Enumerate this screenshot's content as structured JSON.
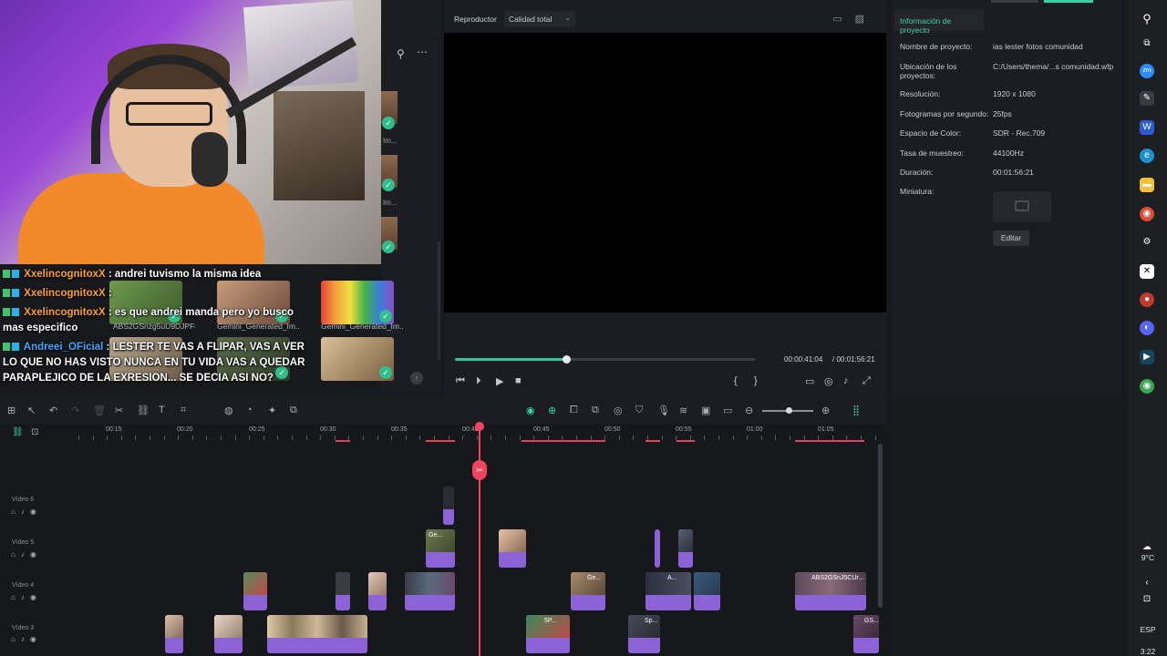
{
  "chat": [
    {
      "user": "XxelincognitoxX",
      "msg": " : andrei tuvismo la misma idea",
      "color": "orange"
    },
    {
      "user": "XxelincognitoxX",
      "msg": " :",
      "color": "orange"
    },
    {
      "user": "XxelincognitoxX",
      "msg": " : es que andrei manda pero yo busco mas especifico",
      "color": "orange"
    },
    {
      "user": "Andreei_OFicial",
      "msg": " : LESTER TE VAS A FLIPAR, VAS A VER LO QUE NO HAS VISTO NUNCA EN TU VIDA VAS A QUEDAR PARAPLEJICO DE LA EXRESION... SE DECIA ASI NO?",
      "color": "blue"
    }
  ],
  "media": {
    "thumb_labels": [
      "ABS2GSnzg5uU9DJPF8...",
      "Gemini_Generated_Im...",
      "Gemini_Generated_Im...",
      "Gemini_Generated_Im..."
    ],
    "side_labels": [
      "Im...",
      "Im...",
      "Im...",
      "Generated_Im..."
    ]
  },
  "player": {
    "title": "Reproductor",
    "quality": "Calidad total",
    "time_current": "00:00:41:04",
    "time_total": "/ 00:01:56:21",
    "progress": 0.37
  },
  "project_info": {
    "tab": "Información de proyecto",
    "rows": [
      {
        "label": "Nombre de proyecto:",
        "value": "ias lester fotos comunidad"
      },
      {
        "label": "Ubicación de los proyectos:",
        "value": "C:/Users/thema/...s comunidad.wfp"
      },
      {
        "label": "Resolución:",
        "value": "1920 x 1080"
      },
      {
        "label": "Fotogramas por segundo:",
        "value": "25fps"
      },
      {
        "label": "Espacio de Color:",
        "value": "SDR - Rec.709"
      },
      {
        "label": "Tasa de muestreo:",
        "value": "44100Hz"
      },
      {
        "label": "Duración:",
        "value": "00:01:56:21"
      },
      {
        "label": "Miniatura:",
        "value": ""
      }
    ],
    "edit_label": "Editar"
  },
  "timeline": {
    "ruler": [
      "00:15",
      "00:20",
      "00:25",
      "00:30",
      "00:35",
      "00:40",
      "00:45",
      "00:50",
      "00:55",
      "01:00",
      "01:05"
    ],
    "tracks": [
      "Vídeo 6",
      "Vídeo 5",
      "Vídeo 4",
      "Vídeo 3"
    ],
    "clip_labels": [
      "Ge...",
      "Ge...",
      "A...",
      "ABS2GSnJ5CUr...",
      "5P...",
      "Sp...",
      "GS..."
    ]
  },
  "taskbar": {
    "weather": "9°C",
    "lang": "ESP",
    "time": "3:22"
  }
}
